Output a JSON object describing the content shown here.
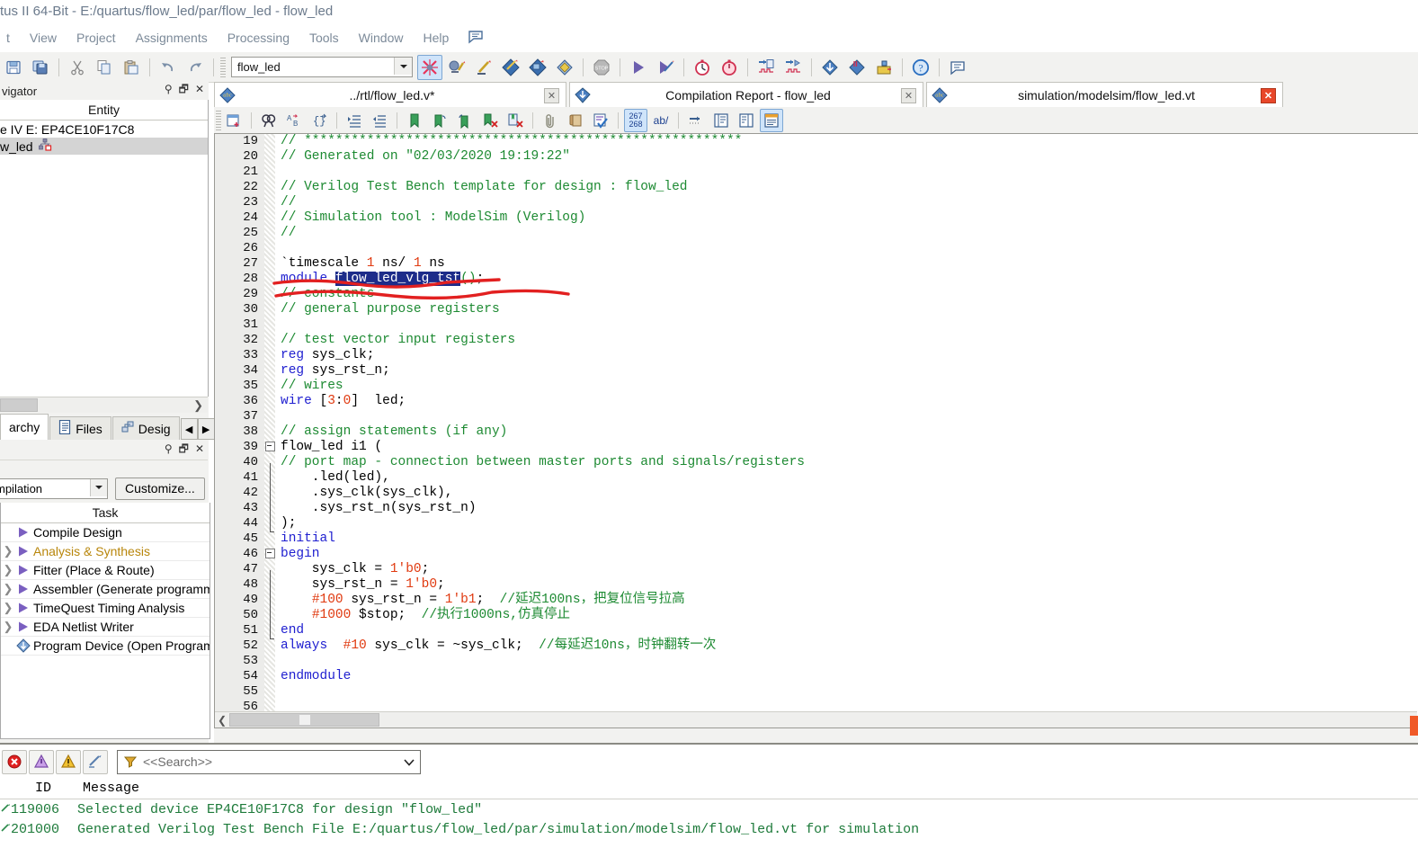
{
  "window": {
    "title": "tus II 64-Bit - E:/quartus/flow_led/par/flow_led - flow_led"
  },
  "menubar": {
    "items": [
      {
        "label": "t"
      },
      {
        "label": "View"
      },
      {
        "label": "Project"
      },
      {
        "label": "Assignments"
      },
      {
        "label": "Processing"
      },
      {
        "label": "Tools"
      },
      {
        "label": "Window"
      },
      {
        "label": "Help"
      }
    ],
    "trailing_icon": "message-balloon-icon"
  },
  "toolbar": {
    "project_combo_value": "flow_led",
    "icons": [
      "save-icon",
      "save-all-icon",
      "cut-icon",
      "copy-icon",
      "paste-icon",
      "undo-icon",
      "redo-icon"
    ],
    "right_icons": [
      "compilation-stop-x-icon",
      "analysis-synthesis-icon",
      "pencil-icon",
      "compile-design-icon",
      "start-compilation-icon",
      "compile-layers-icon",
      "stop-icon",
      "play-icon",
      "run-flow-icon",
      "timing-analyzer-icon",
      "timequest-icon",
      "waveform-in-icon",
      "waveform-out-icon",
      "programmer-down-icon",
      "programmer-pin-icon",
      "chip-planner-icon",
      "help-icon",
      "messages-icon"
    ]
  },
  "project_navigator": {
    "title": "vigator",
    "column_header": "Entity",
    "rows": [
      {
        "label": "e IV E: EP4CE10F17C8",
        "selected": false,
        "icon": null
      },
      {
        "label": "w_led",
        "selected": true,
        "icon": "entity-hierarchy-icon"
      }
    ],
    "tabs": [
      {
        "label": "archy",
        "icon": "hierarchy-icon",
        "active": true
      },
      {
        "label": "Files",
        "icon": "files-icon",
        "active": false
      },
      {
        "label": "Desig",
        "icon": "design-units-icon",
        "active": false
      }
    ],
    "nav_prev": "◀",
    "nav_next": "▶"
  },
  "tasks_panel": {
    "flow_combo_value": "mpilation",
    "customize_label": "Customize...",
    "column_header": "Task",
    "rows": [
      {
        "label": "Compile Design",
        "expandable": false,
        "icon": "run-arrow-icon",
        "amber": false
      },
      {
        "label": "Analysis & Synthesis",
        "expandable": true,
        "icon": "run-arrow-icon",
        "amber": true
      },
      {
        "label": "Fitter (Place & Route)",
        "expandable": true,
        "icon": "run-arrow-icon",
        "amber": false
      },
      {
        "label": "Assembler (Generate programmin",
        "expandable": true,
        "icon": "run-arrow-icon",
        "amber": false
      },
      {
        "label": "TimeQuest Timing Analysis",
        "expandable": true,
        "icon": "run-arrow-icon",
        "amber": false
      },
      {
        "label": "EDA Netlist Writer",
        "expandable": true,
        "icon": "run-arrow-icon",
        "amber": false
      },
      {
        "label": "Program Device (Open Programmer",
        "expandable": false,
        "icon": "program-device-icon",
        "amber": false
      }
    ]
  },
  "document_tabs": [
    {
      "label": "../rtl/flow_led.v*",
      "icon": "verilog-abc-icon",
      "close": "grey",
      "active": true
    },
    {
      "label": "Compilation Report - flow_led",
      "icon": "compilation-report-icon",
      "close": "grey",
      "active": false
    },
    {
      "label": "simulation/modelsim/flow_led.vt",
      "icon": "verilog-abc-icon",
      "close": "red",
      "active": false
    }
  ],
  "editor_toolbar": {
    "icons": [
      "insert-template-icon",
      "find-icon",
      "replace-icon",
      "goto-line-icon",
      "increase-indent-icon",
      "decrease-indent-icon",
      "bookmark-add-icon",
      "bookmark-next-icon",
      "bookmark-prev-icon",
      "bookmark-clear-icon",
      "bookmark-clear-all-icon",
      "attach-icon",
      "scroll-icon",
      "syntax-check-icon"
    ],
    "line_badge_top": "267",
    "line_badge_bottom": "268",
    "ab_label": "ab/",
    "right_icons": [
      "word-wrap-icon",
      "show-line-numbers-icon",
      "code-fold-icon",
      "show-all-icon"
    ]
  },
  "code": {
    "language": "verilog",
    "first_line": 19,
    "lines": [
      {
        "n": 19,
        "fold": "",
        "tokens": [
          {
            "t": "// ********************************************************",
            "c": "cm"
          }
        ]
      },
      {
        "n": 20,
        "fold": "",
        "tokens": [
          {
            "t": "// Generated on \"02/03/2020 19:19:22\"",
            "c": "cm"
          }
        ]
      },
      {
        "n": 21,
        "fold": "",
        "tokens": []
      },
      {
        "n": 22,
        "fold": "",
        "tokens": [
          {
            "t": "// Verilog Test Bench template for design : flow_led",
            "c": "cm"
          }
        ]
      },
      {
        "n": 23,
        "fold": "",
        "tokens": [
          {
            "t": "//",
            "c": "cm"
          }
        ]
      },
      {
        "n": 24,
        "fold": "",
        "tokens": [
          {
            "t": "// Simulation tool : ModelSim (Verilog)",
            "c": "cm"
          }
        ]
      },
      {
        "n": 25,
        "fold": "",
        "tokens": [
          {
            "t": "//",
            "c": "cm"
          }
        ]
      },
      {
        "n": 26,
        "fold": "",
        "tokens": []
      },
      {
        "n": 27,
        "fold": "",
        "tokens": [
          {
            "t": "`timescale ",
            "c": "pl"
          },
          {
            "t": "1",
            "c": "num"
          },
          {
            "t": " ns/ ",
            "c": "pl"
          },
          {
            "t": "1",
            "c": "num"
          },
          {
            "t": " ns",
            "c": "pl"
          }
        ]
      },
      {
        "n": 28,
        "fold": "",
        "tokens": [
          {
            "t": "module ",
            "c": "kw"
          },
          {
            "t": "flow_led_vlg_tst",
            "c": "hl"
          },
          {
            "t": "()",
            "c": "op"
          },
          {
            "t": ";",
            "c": "pl"
          }
        ]
      },
      {
        "n": 29,
        "fold": "",
        "tokens": [
          {
            "t": "// constants",
            "c": "cm"
          }
        ]
      },
      {
        "n": 30,
        "fold": "",
        "tokens": [
          {
            "t": "// general purpose registers",
            "c": "cm"
          }
        ]
      },
      {
        "n": 31,
        "fold": "",
        "tokens": []
      },
      {
        "n": 32,
        "fold": "",
        "tokens": [
          {
            "t": "// test vector input registers",
            "c": "cm"
          }
        ]
      },
      {
        "n": 33,
        "fold": "",
        "tokens": [
          {
            "t": "reg",
            "c": "kw"
          },
          {
            "t": " sys_clk;",
            "c": "pl"
          }
        ]
      },
      {
        "n": 34,
        "fold": "",
        "tokens": [
          {
            "t": "reg",
            "c": "kw"
          },
          {
            "t": " sys_rst_n;",
            "c": "pl"
          }
        ]
      },
      {
        "n": 35,
        "fold": "",
        "tokens": [
          {
            "t": "// wires",
            "c": "cm"
          }
        ]
      },
      {
        "n": 36,
        "fold": "",
        "tokens": [
          {
            "t": "wire",
            "c": "kw"
          },
          {
            "t": " [",
            "c": "pl"
          },
          {
            "t": "3",
            "c": "num"
          },
          {
            "t": ":",
            "c": "pl"
          },
          {
            "t": "0",
            "c": "num"
          },
          {
            "t": "]  led;",
            "c": "pl"
          }
        ]
      },
      {
        "n": 37,
        "fold": "",
        "tokens": []
      },
      {
        "n": 38,
        "fold": "",
        "tokens": [
          {
            "t": "// assign statements (if any)",
            "c": "cm"
          }
        ]
      },
      {
        "n": 39,
        "fold": "box",
        "tokens": [
          {
            "t": "flow_led i1 (",
            "c": "pl"
          }
        ]
      },
      {
        "n": 40,
        "fold": "bar",
        "tokens": [
          {
            "t": "// port map - connection between master ports and signals/registers",
            "c": "cm"
          }
        ]
      },
      {
        "n": 41,
        "fold": "bar",
        "tokens": [
          {
            "t": "    .led(led),",
            "c": "pl"
          }
        ]
      },
      {
        "n": 42,
        "fold": "bar",
        "tokens": [
          {
            "t": "    .sys_clk(sys_clk),",
            "c": "pl"
          }
        ]
      },
      {
        "n": 43,
        "fold": "bar",
        "tokens": [
          {
            "t": "    .sys_rst_n(sys_rst_n)",
            "c": "pl"
          }
        ]
      },
      {
        "n": 44,
        "fold": "end",
        "tokens": [
          {
            "t": ");",
            "c": "pl"
          }
        ]
      },
      {
        "n": 45,
        "fold": "",
        "tokens": [
          {
            "t": "initial",
            "c": "kw"
          }
        ]
      },
      {
        "n": 46,
        "fold": "box",
        "tokens": [
          {
            "t": "begin",
            "c": "kw"
          }
        ]
      },
      {
        "n": 47,
        "fold": "bar",
        "tokens": [
          {
            "t": "    sys_clk = ",
            "c": "pl"
          },
          {
            "t": "1'b0",
            "c": "num"
          },
          {
            "t": ";",
            "c": "pl"
          }
        ]
      },
      {
        "n": 48,
        "fold": "bar",
        "tokens": [
          {
            "t": "    sys_rst_n = ",
            "c": "pl"
          },
          {
            "t": "1'b0",
            "c": "num"
          },
          {
            "t": ";",
            "c": "pl"
          }
        ]
      },
      {
        "n": 49,
        "fold": "bar",
        "tokens": [
          {
            "t": "    ",
            "c": "pl"
          },
          {
            "t": "#100",
            "c": "num"
          },
          {
            "t": " sys_rst_n = ",
            "c": "pl"
          },
          {
            "t": "1'b1",
            "c": "num"
          },
          {
            "t": ";  ",
            "c": "pl"
          },
          {
            "t": "//延迟100ns，把复位信号拉高",
            "c": "cm"
          }
        ]
      },
      {
        "n": 50,
        "fold": "bar",
        "tokens": [
          {
            "t": "    ",
            "c": "pl"
          },
          {
            "t": "#1000",
            "c": "num"
          },
          {
            "t": " $stop;  ",
            "c": "pl"
          },
          {
            "t": "//执行1000ns,仿真停止",
            "c": "cm"
          }
        ]
      },
      {
        "n": 51,
        "fold": "end",
        "tokens": [
          {
            "t": "end",
            "c": "kw"
          }
        ]
      },
      {
        "n": 52,
        "fold": "",
        "tokens": [
          {
            "t": "always",
            "c": "kw"
          },
          {
            "t": "  ",
            "c": "pl"
          },
          {
            "t": "#10",
            "c": "num"
          },
          {
            "t": " sys_clk = ~sys_clk;  ",
            "c": "pl"
          },
          {
            "t": "//每延迟10ns，时钟翻转一次",
            "c": "cm"
          }
        ]
      },
      {
        "n": 53,
        "fold": "",
        "tokens": []
      },
      {
        "n": 54,
        "fold": "",
        "tokens": [
          {
            "t": "endmodule",
            "c": "kw"
          }
        ]
      },
      {
        "n": 55,
        "fold": "",
        "tokens": []
      },
      {
        "n": 56,
        "fold": "",
        "tokens": []
      }
    ],
    "annotation": "red-underline-on-module-name"
  },
  "messages": {
    "filter_buttons": [
      "error-filter-icon",
      "critical-warning-filter-icon",
      "warning-filter-icon",
      "info-filter-icon"
    ],
    "search_placeholder": "<<Search>>",
    "columns": [
      "",
      "ID",
      "Message"
    ],
    "rows": [
      {
        "icon": "info-icon",
        "id": "119006",
        "text": "Selected device EP4CE10F17C8 for design \"flow_led\""
      },
      {
        "icon": "info-icon",
        "id": "201000",
        "text": "Generated Verilog Test Bench File E:/quartus/flow_led/par/simulation/modelsim/flow_led.vt for simulation"
      }
    ]
  },
  "colors": {
    "comment_green": "#1d8a32",
    "keyword_blue": "#2020d0",
    "number_red": "#e03a10",
    "selection_navy": "#1d2c8a",
    "annotation_red": "#e22020",
    "amber_task": "#b8860b",
    "panel_grey": "#f2f2f0"
  }
}
